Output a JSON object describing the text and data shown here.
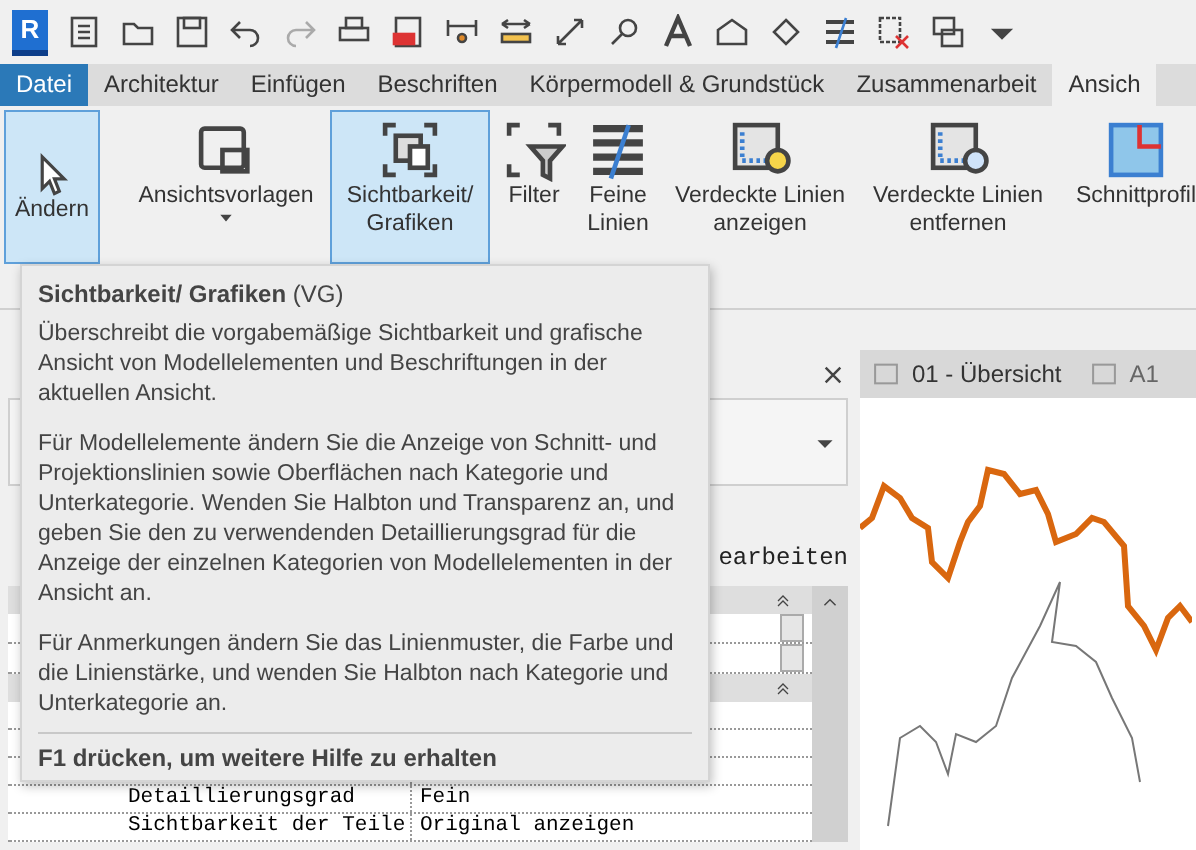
{
  "quick_access": {
    "app_letter": "R"
  },
  "tabs": [
    {
      "label": "Datei",
      "selected": false,
      "kind": "file"
    },
    {
      "label": "Architektur",
      "selected": false,
      "kind": "tab"
    },
    {
      "label": "Einfügen",
      "selected": false,
      "kind": "tab"
    },
    {
      "label": "Beschriften",
      "selected": false,
      "kind": "tab"
    },
    {
      "label": "Körpermodell & Grundstück",
      "selected": false,
      "kind": "tab"
    },
    {
      "label": "Zusammenarbeit",
      "selected": false,
      "kind": "tab"
    },
    {
      "label": "Ansich",
      "selected": true,
      "kind": "tab"
    }
  ],
  "ribbon": [
    {
      "label": "Ändern",
      "selected": true,
      "dropdown": false
    },
    {
      "label": "Ansichtsvorlagen",
      "selected": false,
      "dropdown": true
    },
    {
      "label": "Sichtbarkeit/ Grafiken",
      "selected": true,
      "dropdown": false
    },
    {
      "label": "Filter",
      "selected": false,
      "dropdown": false
    },
    {
      "label": "Feine Linien",
      "selected": false,
      "dropdown": false
    },
    {
      "label": "Verdeckte Linien anzeigen",
      "selected": false,
      "dropdown": false
    },
    {
      "label": "Verdeckte Linien entfernen",
      "selected": false,
      "dropdown": false
    },
    {
      "label": "Schnittprofil",
      "selected": false,
      "dropdown": false
    }
  ],
  "properties": {
    "edit_type": "earbeiten",
    "rows": [
      {
        "kind": "group"
      },
      {
        "kind": "field"
      },
      {
        "kind": "field"
      },
      {
        "kind": "group"
      },
      {
        "kind": "row",
        "name": "",
        "value": ""
      },
      {
        "kind": "row",
        "name": "",
        "value": ""
      },
      {
        "kind": "row",
        "name": "",
        "value": ""
      },
      {
        "kind": "row",
        "name": "Detaillierungsgrad",
        "value": "Fein"
      },
      {
        "kind": "row",
        "name": "Sichtbarkeit der Teile",
        "value": "Original anzeigen"
      }
    ]
  },
  "view_tabs": [
    {
      "label": "01 - Übersicht",
      "selected": true
    },
    {
      "label": "A1",
      "selected": false
    }
  ],
  "tooltip": {
    "title": "**Sichtbarkeit/ Grafiken** (VG)",
    "paragraphs": [
      "Überschreibt die vorgabemäßige Sichtbarkeit und grafische Ansicht von Modellelementen und Beschriftungen in der aktuellen Ansicht.",
      "Für Modellelemente ändern Sie die Anzeige von Schnitt- und Projektionslinien sowie Oberflächen nach Kategorie und Unterkategorie. Wenden Sie Halbton und Transparenz an, und geben Sie den zu verwendenden Detaillierungsgrad für die Anzeige der einzelnen Kategorien von Modellelementen in der Ansicht an.",
      "Für Anmerkungen ändern Sie das Linienmuster, die Farbe und die Linienstärke, und wenden Sie Halbton nach Kategorie und Unterkategorie an."
    ],
    "footer": "F1 drücken, um weitere Hilfe zu erhalten"
  }
}
